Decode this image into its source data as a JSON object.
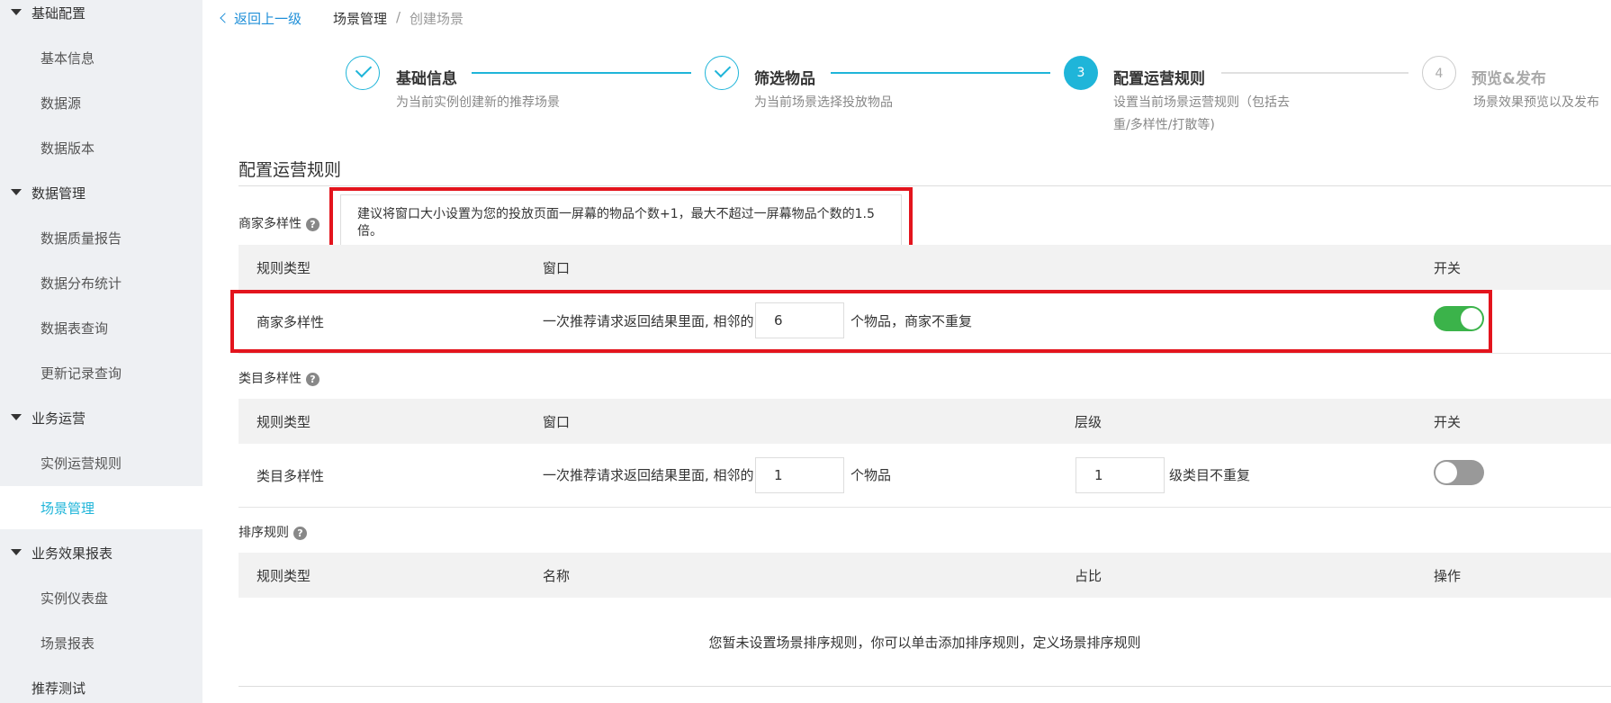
{
  "sidebar": {
    "groups": [
      {
        "label": "基础配置",
        "items": [
          "基本信息",
          "数据源",
          "数据版本"
        ]
      },
      {
        "label": "数据管理",
        "items": [
          "数据质量报告",
          "数据分布统计",
          "数据表查询",
          "更新记录查询"
        ]
      },
      {
        "label": "业务运营",
        "items": [
          "实例运营规则",
          "场景管理"
        ]
      },
      {
        "label": "业务效果报表",
        "items": [
          "实例仪表盘",
          "场景报表"
        ]
      }
    ],
    "active_item": "场景管理",
    "extra": "推荐测试"
  },
  "breadcrumb": {
    "back": "返回上一级",
    "parent": "场景管理",
    "sep": "/",
    "current": "创建场景"
  },
  "steps": [
    {
      "marker": "",
      "title": "基础信息",
      "desc": "为当前实例创建新的推荐场景",
      "state": "done"
    },
    {
      "marker": "",
      "title": "筛选物品",
      "desc": "为当前场景选择投放物品",
      "state": "done"
    },
    {
      "marker": "3",
      "title": "配置运营规则",
      "desc_line1": "设置当前场景运营规则（包括去",
      "desc_line2": "重/多样性/打散等)",
      "state": "current"
    },
    {
      "marker": "4",
      "title": "预览&发布",
      "desc": "场景效果预览以及发布",
      "state": "todo"
    }
  ],
  "section_title": "配置运营规则",
  "merchant": {
    "label": "商家多样性",
    "help": "?",
    "tooltip": "建议将窗口大小设置为您的投放页面一屏幕的物品个数+1，最大不超过一屏幕物品个数的1.5倍。",
    "headers": {
      "type": "规则类型",
      "window": "窗口",
      "switch": "开关"
    },
    "row": {
      "type": "商家多样性",
      "prefix": "一次推荐请求返回结果里面, 相邻的",
      "value": "6",
      "suffix": "个物品，商家不重复",
      "enabled": true
    }
  },
  "category": {
    "label": "类目多样性",
    "help": "?",
    "headers": {
      "type": "规则类型",
      "window": "窗口",
      "level": "层级",
      "switch": "开关"
    },
    "row": {
      "type": "类目多样性",
      "prefix": "一次推荐请求返回结果里面, 相邻的",
      "value": "1",
      "suffix": "个物品",
      "level_value": "1",
      "level_suffix": "级类目不重复",
      "enabled": false
    }
  },
  "sort": {
    "label": "排序规则",
    "help": "?",
    "headers": {
      "type": "规则类型",
      "name": "名称",
      "ratio": "占比",
      "action": "操作"
    },
    "empty": "您暂未设置场景排序规则，你可以单击添加排序规则，定义场景排序规则"
  },
  "colors": {
    "accent": "#1fb5d9",
    "toggle_on": "#3bb34a",
    "highlight_box": "#e3141d",
    "link": "#1e8fd8"
  }
}
